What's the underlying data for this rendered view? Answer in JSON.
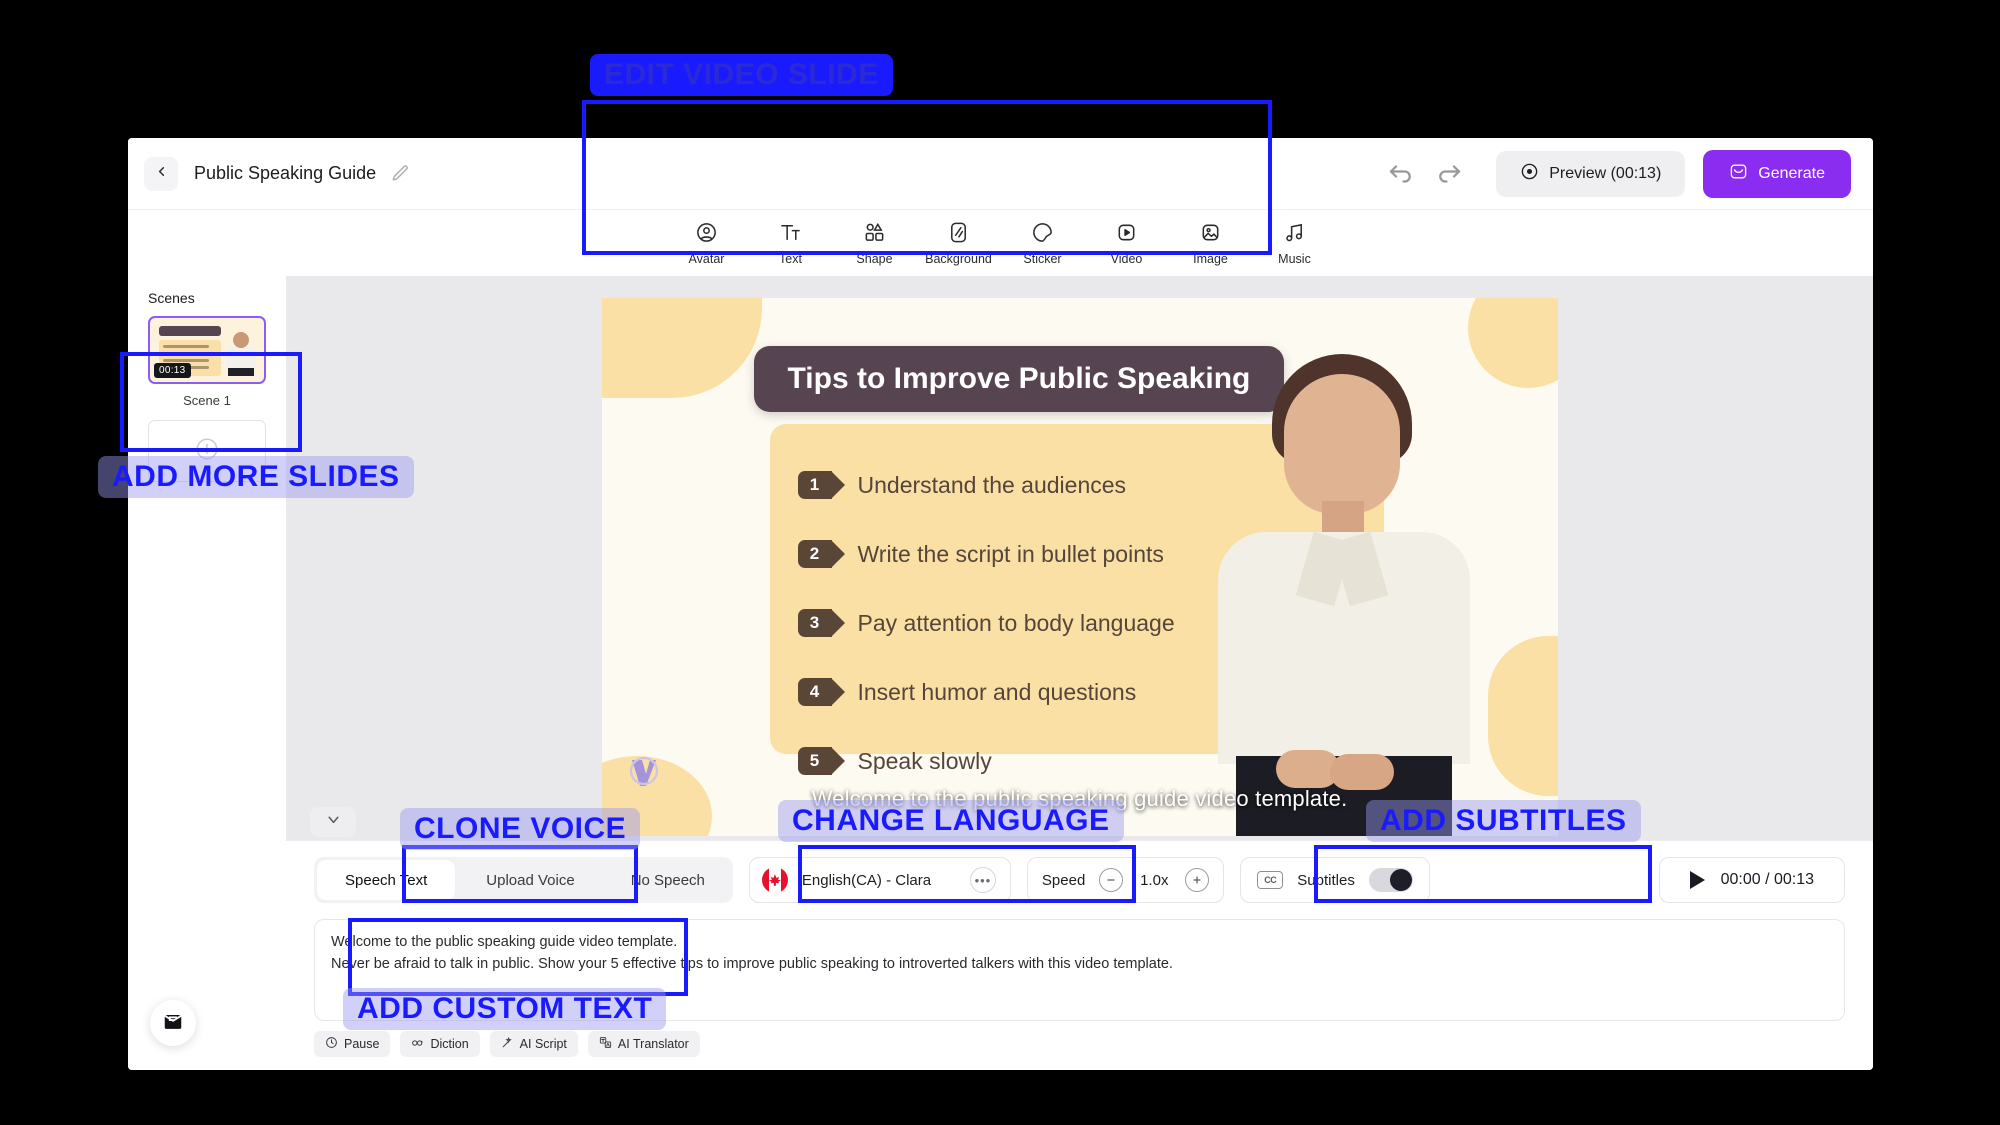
{
  "header": {
    "back_icon": "chevron-left-icon",
    "project_title": "Public Speaking Guide",
    "edit_icon": "pencil-icon",
    "undo_icon": "undo-icon",
    "redo_icon": "redo-icon",
    "preview_label": "Preview (00:13)",
    "preview_icon": "play-circle-icon",
    "generate_label": "Generate",
    "generate_icon": "sparkle-box-icon",
    "accent_color": "#8b2df0"
  },
  "toolbar": {
    "items": [
      {
        "label": "Avatar",
        "icon": "avatar-icon"
      },
      {
        "label": "Text",
        "icon": "text-icon"
      },
      {
        "label": "Shape",
        "icon": "shape-icon"
      },
      {
        "label": "Background",
        "icon": "background-icon"
      },
      {
        "label": "Sticker",
        "icon": "sticker-icon"
      },
      {
        "label": "Video",
        "icon": "video-icon"
      },
      {
        "label": "Image",
        "icon": "image-icon"
      },
      {
        "label": "Music",
        "icon": "music-icon"
      }
    ]
  },
  "sidebar": {
    "title": "Scenes",
    "scene": {
      "duration": "00:13",
      "label": "Scene 1"
    },
    "add_slide_icon": "plus-circle-icon"
  },
  "slide": {
    "title": "Tips to Improve Public Speaking",
    "bullets": [
      {
        "num": "1",
        "text": "Understand the audiences"
      },
      {
        "num": "2",
        "text": "Write the script in bullet points"
      },
      {
        "num": "3",
        "text": "Pay attention to body language"
      },
      {
        "num": "4",
        "text": "Insert humor and questions"
      },
      {
        "num": "5",
        "text": "Speak slowly"
      }
    ],
    "subtitle_overlay": "Welcome to the public speaking guide video template.",
    "watermark_icon": "v-logo-icon",
    "title_bg": "#564450",
    "card_bg": "#fbe0a5"
  },
  "bottom": {
    "collapse_icon": "chevron-down-icon",
    "tabs": [
      {
        "label": "Speech Text",
        "active": true
      },
      {
        "label": "Upload Voice",
        "active": false
      },
      {
        "label": "No Speech",
        "active": false
      }
    ],
    "language": {
      "name": "English(CA) - Clara",
      "flag_icon": "canada-flag-icon",
      "more_icon": "ellipsis-icon"
    },
    "speed": {
      "label": "Speed",
      "value": "1.0x",
      "minus_icon": "minus-circle-icon",
      "plus_icon": "plus-circle-icon"
    },
    "subtitles": {
      "label": "Subtitles",
      "cc_icon": "cc-icon",
      "enabled": true
    },
    "player": {
      "play_icon": "play-icon",
      "time": "00:00 / 00:13"
    },
    "script": {
      "line1": "Welcome to the public speaking guide video template.",
      "line2": "Never be afraid to talk in public. Show your 5 effective tips to improve public speaking to introverted talkers with this video template."
    },
    "mini_tools": [
      {
        "label": "Pause",
        "icon": "clock-icon"
      },
      {
        "label": "Diction",
        "icon": "diction-icon"
      },
      {
        "label": "AI Script",
        "icon": "magic-wand-icon"
      },
      {
        "label": "AI Translator",
        "icon": "translate-icon"
      }
    ],
    "chat_icon": "message-icon"
  },
  "annotations": [
    {
      "id": "edit-video-slide",
      "label": "EDIT VIDEO SLIDE"
    },
    {
      "id": "add-more-slides",
      "label": "ADD MORE SLIDES"
    },
    {
      "id": "clone-voice",
      "label": "CLONE VOICE"
    },
    {
      "id": "change-language",
      "label": "CHANGE LANGUAGE"
    },
    {
      "id": "add-subtitles",
      "label": "ADD SUBTITLES"
    },
    {
      "id": "add-custom-text",
      "label": "ADD CUSTOM TEXT"
    }
  ]
}
